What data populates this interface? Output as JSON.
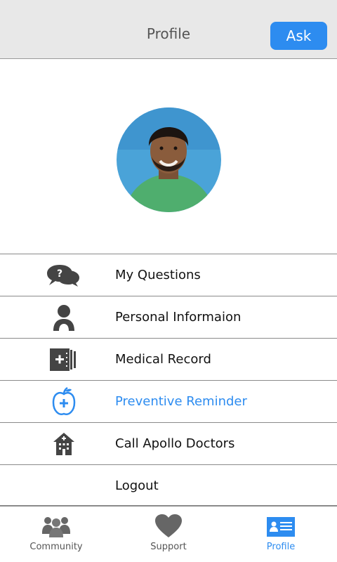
{
  "header": {
    "title": "Profile",
    "ask_label": "Ask"
  },
  "menu": {
    "items": [
      {
        "label": "My Questions",
        "icon": "chat-question-icon"
      },
      {
        "label": "Personal Informaion",
        "icon": "person-icon"
      },
      {
        "label": "Medical Record",
        "icon": "medical-record-icon"
      },
      {
        "label": "Preventive Reminder",
        "icon": "apple-plus-icon",
        "active": true
      },
      {
        "label": "Call Apollo Doctors",
        "icon": "hospital-icon"
      },
      {
        "label": "Logout"
      }
    ]
  },
  "tabbar": {
    "tabs": [
      {
        "label": "Community",
        "icon": "community-icon"
      },
      {
        "label": "Support",
        "icon": "heart-icon"
      },
      {
        "label": "Profile",
        "icon": "profile-card-icon",
        "active": true
      }
    ]
  },
  "colors": {
    "accent": "#2d8cf0",
    "header_bg": "#e8e8e8",
    "icon_gray": "#444444"
  }
}
